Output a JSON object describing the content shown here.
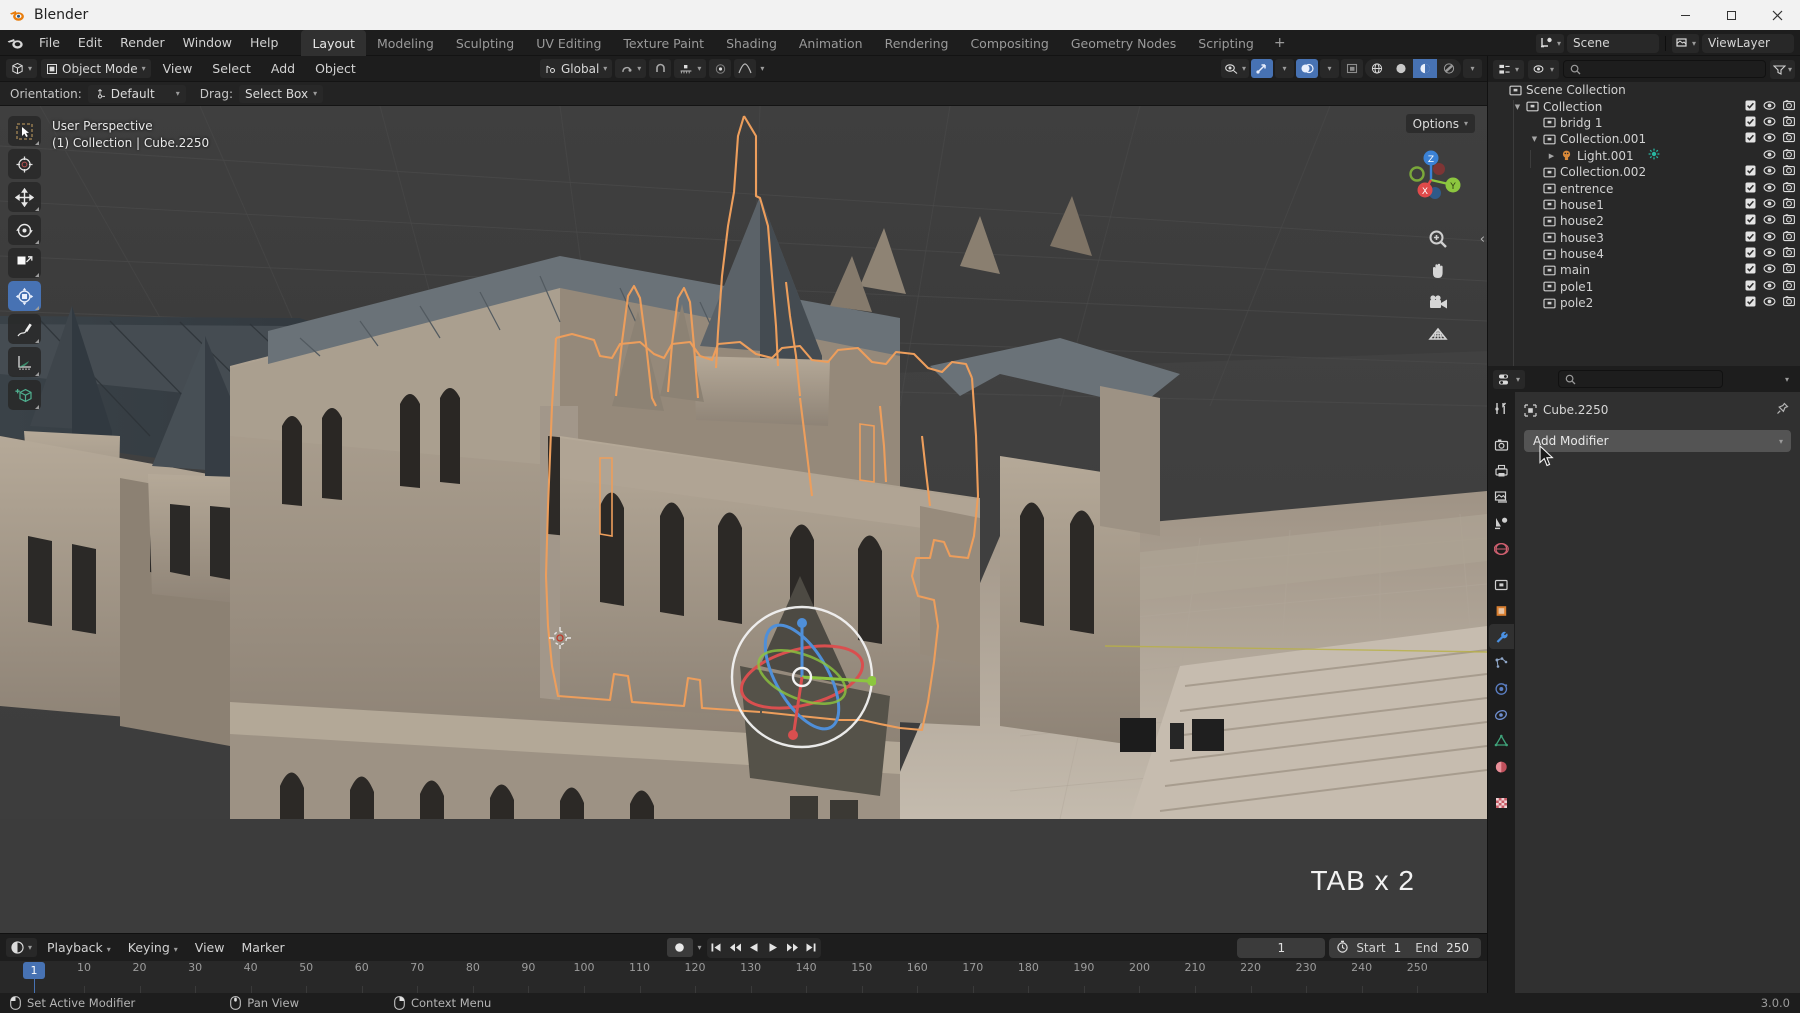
{
  "titlebar": {
    "app_icon": "blender-logo-icon",
    "title": "Blender",
    "minimize": "minimize-icon",
    "maximize": "maximize-icon",
    "close": "close-icon"
  },
  "topbar": {
    "menus": [
      "File",
      "Edit",
      "Render",
      "Window",
      "Help"
    ],
    "workspaces": [
      {
        "label": "Layout",
        "active": true
      },
      {
        "label": "Modeling",
        "active": false
      },
      {
        "label": "Sculpting",
        "active": false
      },
      {
        "label": "UV Editing",
        "active": false
      },
      {
        "label": "Texture Paint",
        "active": false
      },
      {
        "label": "Shading",
        "active": false
      },
      {
        "label": "Animation",
        "active": false
      },
      {
        "label": "Rendering",
        "active": false
      },
      {
        "label": "Compositing",
        "active": false
      },
      {
        "label": "Geometry Nodes",
        "active": false
      },
      {
        "label": "Scripting",
        "active": false
      }
    ],
    "add_workspace": "+",
    "scene_label": "Scene",
    "viewlayer_label": "ViewLayer"
  },
  "viewport_header": {
    "editor_type": "editor-type-3d-viewport",
    "mode": "Object Mode",
    "menus": [
      "View",
      "Select",
      "Add",
      "Object"
    ],
    "transform_orientation": "Global",
    "snap_icon": "magnet-icon",
    "proportional_icon": "proportional-edit-icon",
    "visibility_icon": "eye-icon",
    "gizmo_icon": "gizmo-icon",
    "overlays_icon": "overlays-icon",
    "xray_icon": "xray-icon",
    "shading_modes": [
      "wireframe",
      "solid",
      "material-preview",
      "rendered"
    ],
    "shading_active": "material-preview"
  },
  "tool_settings": {
    "orientation_label": "Orientation:",
    "orientation_value": "Default",
    "drag_label": "Drag:",
    "drag_value": "Select Box"
  },
  "viewport": {
    "options_label": "Options",
    "overlay_line1": "User Perspective",
    "overlay_line2": "(1) Collection | Cube.2250",
    "tab_hint": "TAB x 2",
    "gizmo_axes": [
      "X",
      "Y",
      "Z"
    ],
    "nav_buttons": [
      "zoom-icon",
      "pan-hand-icon",
      "camera-view-icon",
      "toggle-ortho-icon"
    ],
    "toolbar": [
      {
        "name": "tweak-tool",
        "icon": "cursor-arrow-icon",
        "active": false
      },
      {
        "name": "cursor-tool",
        "icon": "3d-cursor-icon",
        "active": false
      },
      {
        "name": "move-tool",
        "icon": "move-arrows-icon",
        "active": false
      },
      {
        "name": "rotate-tool",
        "icon": "rotate-icon",
        "active": false
      },
      {
        "name": "scale-tool",
        "icon": "scale-icon",
        "active": false
      },
      {
        "name": "transform-tool",
        "icon": "transform-icon",
        "active": true
      },
      {
        "name": "annotate-tool",
        "icon": "pencil-icon",
        "active": false
      },
      {
        "name": "measure-tool",
        "icon": "ruler-icon",
        "active": false
      },
      {
        "name": "add-cube-tool",
        "icon": "add-cube-icon",
        "active": false
      }
    ]
  },
  "outliner": {
    "display_mode": "View Layer",
    "search_placeholder": "",
    "filter_icon": "filter-icon",
    "rows": [
      {
        "label": "Scene Collection",
        "indent": 0,
        "icon": "collection-icon",
        "disclosure": "",
        "checkbox": false,
        "eye": false,
        "camera": false
      },
      {
        "label": "Collection",
        "indent": 1,
        "icon": "collection-icon",
        "disclosure": "down",
        "checkbox": true,
        "eye": true,
        "camera": true
      },
      {
        "label": "bridg 1",
        "indent": 2,
        "icon": "collection-icon",
        "disclosure": "",
        "checkbox": true,
        "eye": true,
        "camera": true
      },
      {
        "label": "Collection.001",
        "indent": 2,
        "icon": "collection-icon",
        "disclosure": "down",
        "checkbox": true,
        "eye": true,
        "camera": true
      },
      {
        "label": "Light.001",
        "indent": 3,
        "icon": "light-icon",
        "disclosure": "right",
        "checkbox": false,
        "eye": true,
        "camera": true,
        "extra_icon": "light-data-icon"
      },
      {
        "label": "Collection.002",
        "indent": 2,
        "icon": "collection-icon",
        "disclosure": "",
        "checkbox": true,
        "eye": true,
        "camera": true
      },
      {
        "label": "entrence",
        "indent": 2,
        "icon": "collection-icon",
        "disclosure": "",
        "checkbox": true,
        "eye": true,
        "camera": true
      },
      {
        "label": "house1",
        "indent": 2,
        "icon": "collection-icon",
        "disclosure": "",
        "checkbox": true,
        "eye": true,
        "camera": true
      },
      {
        "label": "house2",
        "indent": 2,
        "icon": "collection-icon",
        "disclosure": "",
        "checkbox": true,
        "eye": true,
        "camera": true
      },
      {
        "label": "house3",
        "indent": 2,
        "icon": "collection-icon",
        "disclosure": "",
        "checkbox": true,
        "eye": true,
        "camera": true
      },
      {
        "label": "house4",
        "indent": 2,
        "icon": "collection-icon",
        "disclosure": "",
        "checkbox": true,
        "eye": true,
        "camera": true
      },
      {
        "label": "main",
        "indent": 2,
        "icon": "collection-icon",
        "disclosure": "",
        "checkbox": true,
        "eye": true,
        "camera": true
      },
      {
        "label": "pole1",
        "indent": 2,
        "icon": "collection-icon",
        "disclosure": "",
        "checkbox": true,
        "eye": true,
        "camera": true
      },
      {
        "label": "pole2",
        "indent": 2,
        "icon": "collection-icon",
        "disclosure": "",
        "checkbox": true,
        "eye": true,
        "camera": true
      }
    ]
  },
  "properties": {
    "object_name": "Cube.2250",
    "add_modifier_label": "Add Modifier",
    "pin_icon": "pin-icon",
    "search_placeholder": "",
    "tabs": [
      {
        "name": "tool-tab",
        "icon": "tool-icon",
        "active": false
      },
      {
        "name": "render-tab",
        "icon": "camera-back-icon",
        "active": false
      },
      {
        "name": "output-tab",
        "icon": "printer-icon",
        "active": false
      },
      {
        "name": "view-layer-tab",
        "icon": "images-icon",
        "active": false
      },
      {
        "name": "scene-tab",
        "icon": "scene-cone-icon",
        "active": false
      },
      {
        "name": "world-tab",
        "icon": "world-globe-icon",
        "active": false
      },
      {
        "name": "collection-tab",
        "icon": "collection-icon",
        "active": false
      },
      {
        "name": "object-tab",
        "icon": "object-square-icon",
        "active": false
      },
      {
        "name": "modifier-tab",
        "icon": "wrench-icon",
        "active": true
      },
      {
        "name": "particles-tab",
        "icon": "particles-icon",
        "active": false
      },
      {
        "name": "physics-tab",
        "icon": "physics-orbit-icon",
        "active": false
      },
      {
        "name": "constraints-tab",
        "icon": "constraint-icon",
        "active": false
      },
      {
        "name": "data-tab",
        "icon": "mesh-data-triangle-icon",
        "active": false
      },
      {
        "name": "material-tab",
        "icon": "material-sphere-icon",
        "active": false
      },
      {
        "name": "texture-tab",
        "icon": "texture-checker-icon",
        "active": false
      }
    ]
  },
  "timeline": {
    "editor_icon": "timeline-editor-icon",
    "menus": [
      "Playback",
      "Keying",
      "View",
      "Marker"
    ],
    "auto_key_icon": "record-dot-icon",
    "playback_buttons": [
      "jump-start-icon",
      "prev-keyframe-icon",
      "play-reverse-icon",
      "play-icon",
      "next-keyframe-icon",
      "jump-end-icon"
    ],
    "current_frame": "1",
    "clock_icon": "stopwatch-icon",
    "start_label": "Start",
    "start_value": "1",
    "end_label": "End",
    "end_value": "250",
    "playhead_frame": "1",
    "ticks": [
      10,
      20,
      30,
      40,
      50,
      60,
      70,
      80,
      90,
      100,
      110,
      120,
      130,
      140,
      150,
      160,
      170,
      180,
      190,
      200,
      210,
      220,
      230,
      240,
      250
    ]
  },
  "statusbar": {
    "items": [
      {
        "icon": "mouse-left-click-icon",
        "label": "Set Active Modifier"
      },
      {
        "icon": "mouse-middle-click-icon",
        "label": "Pan View"
      },
      {
        "icon": "mouse-right-click-icon",
        "label": "Context Menu"
      }
    ],
    "version": "3.0.0"
  },
  "colors": {
    "accent_blue": "#4772b3",
    "selection_orange": "#ed9e5c",
    "panel_bg": "#303030",
    "header_bg": "#1d1d1d",
    "editor_bg": "#282828",
    "axis_x": "#e04a4a",
    "axis_y": "#8cc63f",
    "axis_z": "#3b82d6"
  }
}
